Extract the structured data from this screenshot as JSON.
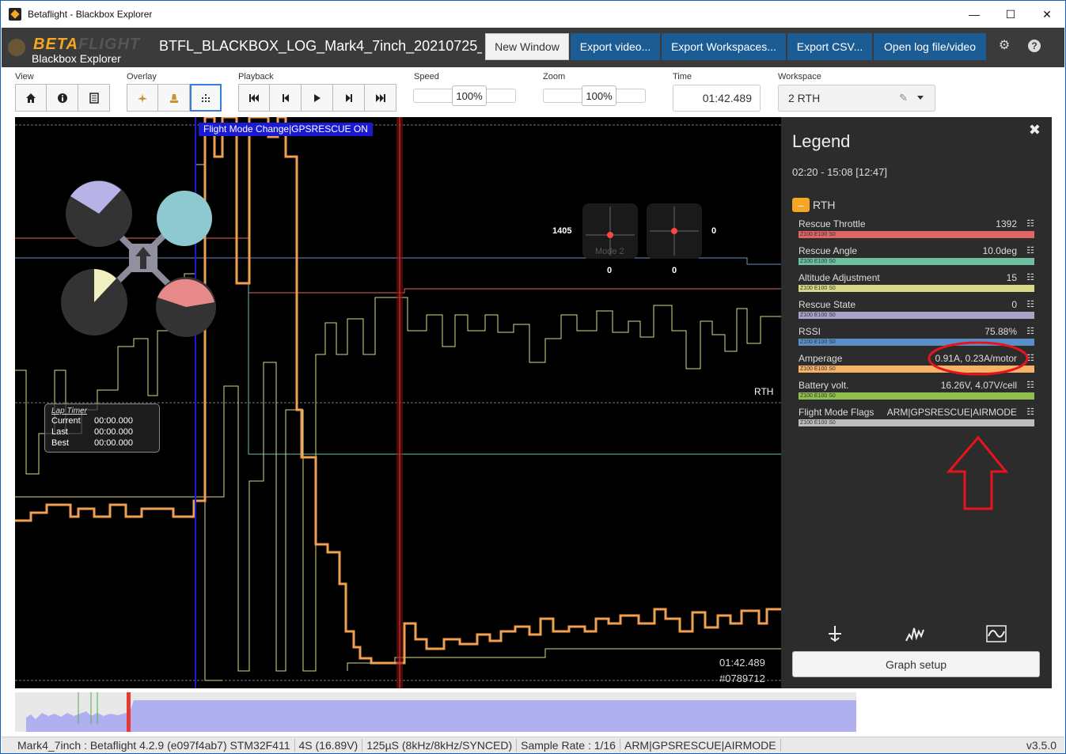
{
  "window": {
    "title": "Betaflight - Blackbox Explorer",
    "minimize": "—",
    "maximize": "☐",
    "close": "✕"
  },
  "header": {
    "logo_beta": "BETA",
    "logo_flight": "FLIGHT",
    "logo_sub": "Blackbox Explorer",
    "log_title": "BTFL_BLACKBOX_LOG_Mark4_7inch_20210725_",
    "buttons": {
      "new_window": "New Window",
      "export_video": "Export video...",
      "export_workspaces": "Export Workspaces...",
      "export_csv": "Export CSV...",
      "open_log": "Open log file/video"
    }
  },
  "toolbar": {
    "view_label": "View",
    "overlay_label": "Overlay",
    "playback_label": "Playback",
    "speed_label": "Speed",
    "speed_value": "100%",
    "zoom_label": "Zoom",
    "zoom_value": "100%",
    "time_label": "Time",
    "time_value": "01:42.489",
    "workspace_label": "Workspace",
    "workspace_value": "2 RTH"
  },
  "graph": {
    "flight_mode_change": "Flight Mode Change|GPSRESCUE ON",
    "rth_label": "RTH",
    "stick_left_value": "1405",
    "stick_right_value": "0",
    "stick_left_bottom": "0",
    "stick_right_bottom": "0",
    "mode_label": "Mode 2",
    "lap_timer": {
      "title": "Lap Timer",
      "current_label": "Current",
      "current": "00:00.000",
      "last_label": "Last",
      "last": "00:00.000",
      "best_label": "Best",
      "best": "00:00.000"
    },
    "time": "01:42.489",
    "frame": "#0789712"
  },
  "legend": {
    "title": "Legend",
    "range": "02:20 - 15:08 [12:47]",
    "group": "RTH",
    "bar_text": "Z100 E100 S0",
    "items": [
      {
        "name": "Rescue Throttle",
        "value": "1392",
        "color": "#e06666"
      },
      {
        "name": "Rescue Angle",
        "value": "10.0deg",
        "color": "#6dbfa0"
      },
      {
        "name": "Altitude Adjustment",
        "value": "15",
        "color": "#d8d88a"
      },
      {
        "name": "Rescue State",
        "value": "0",
        "color": "#a9a3c9"
      },
      {
        "name": "RSSI",
        "value": "75.88%",
        "color": "#5b8fc7"
      },
      {
        "name": "Amperage",
        "value": "0.91A, 0.23A/motor",
        "color": "#f7b267"
      },
      {
        "name": "Battery volt.",
        "value": "16.26V, 4.07V/cell",
        "color": "#8fbf4f"
      },
      {
        "name": "Flight Mode Flags",
        "value": "ARM|GPSRESCUE|AIRMODE",
        "color": "#bdbdbd"
      }
    ],
    "graph_setup": "Graph setup"
  },
  "status": {
    "items": [
      "Mark4_7inch : Betaflight 4.2.9 (e097f4ab7) STM32F411",
      "4S (16.89V)",
      "125µS (8kHz/8kHz/SYNCED)",
      "Sample Rate : 1/16",
      "ARM|GPSRESCUE|AIRMODE"
    ],
    "version": "v3.5.0"
  }
}
